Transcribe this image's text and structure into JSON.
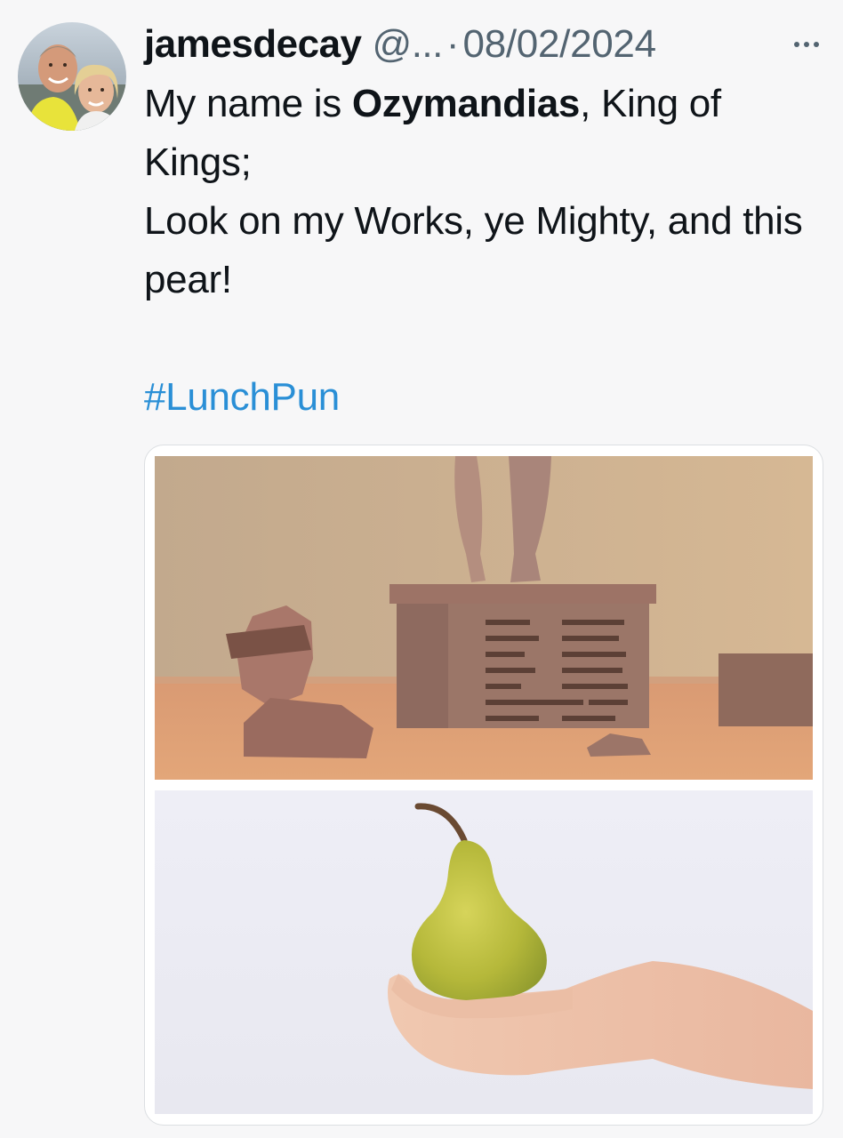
{
  "tweet": {
    "username": "jamesdecay",
    "handle": "@...",
    "separator": "·",
    "date": "08/02/2024",
    "more_icon": "more-dots-icon",
    "text_line1_pre": "My name is ",
    "text_line1_bold": "Ozymandias",
    "text_line1_post": ", King of Kings;",
    "text_line2": "Look on my Works, ye Mighty, and this pear!",
    "hashtag": "#LunchPun",
    "hashtag_color": "#2a8fd6"
  },
  "media": {
    "images": [
      {
        "subject": "ruined-statue-pedestal-image"
      },
      {
        "subject": "hand-holding-pear-image"
      }
    ]
  },
  "colors": {
    "background": "#f7f7f8",
    "text": "#0f1419",
    "secondary_text": "#536471"
  }
}
